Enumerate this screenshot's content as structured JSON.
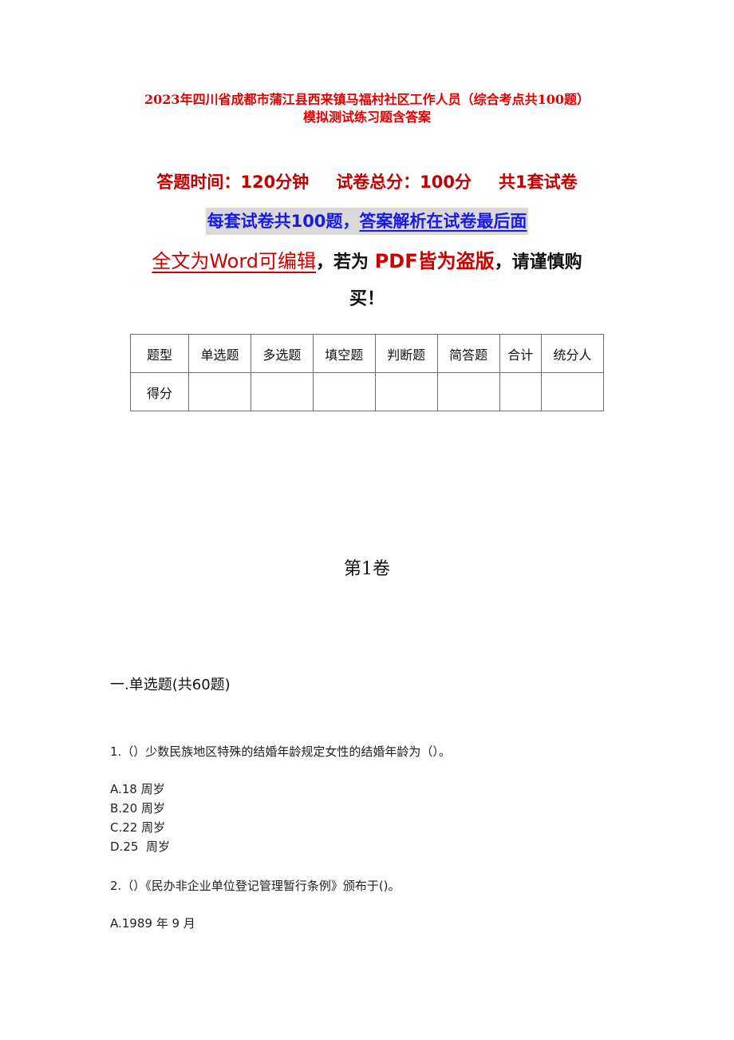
{
  "doc": {
    "title_line1": "2023年四川省成都市蒲江县西来镇马福村社区工作人员（综合考点共100题）",
    "title_line2": "模拟测试练习题含答案",
    "info": {
      "time": "答题时间：120分钟",
      "total": "试卷总分：100分",
      "sets": "共1套试卷"
    },
    "banner": {
      "part1": "每套试卷共100题，",
      "part2": "答案解析在试卷最后面"
    },
    "notice": {
      "editable": "全文为Word可编辑",
      "comma1": "，",
      "if_pdf": "若为",
      "pdf_piracy": "PDF皆为盗版",
      "comma2": "，",
      "careful": "请谨慎购",
      "buy": "买！"
    },
    "score_table": {
      "headers": [
        "题型",
        "单选题",
        "多选题",
        "填空题",
        "判断题",
        "简答题",
        "合计",
        "统分人"
      ],
      "row_label": "得分",
      "row_values": [
        "",
        "",
        "",
        "",
        "",
        "",
        ""
      ]
    },
    "volume_title": "第1卷",
    "section_title": "一.单选题(共60题)",
    "questions": [
      {
        "text": "1.（）少数民族地区特殊的结婚年龄规定女性的结婚年龄为（）。",
        "options": [
          "A.18 周岁",
          "B.20 周岁",
          "C.22 周岁",
          "D.25  周岁"
        ]
      },
      {
        "text": "2.（）《民办非企业单位登记管理暂行条例》颁布于()。",
        "options": [
          "A.1989 年 9 月"
        ]
      }
    ]
  }
}
